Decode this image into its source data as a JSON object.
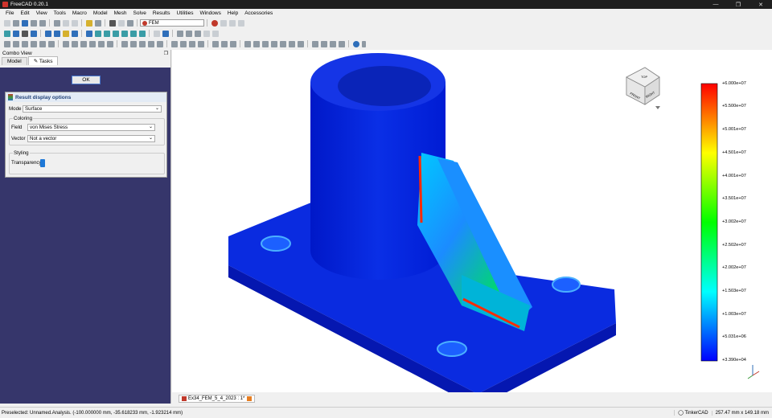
{
  "window": {
    "title": "FreeCAD 0.20.1"
  },
  "menu": [
    "File",
    "Edit",
    "View",
    "Tools",
    "Macro",
    "Model",
    "Mesh",
    "Solve",
    "Results",
    "Utilities",
    "Windows",
    "Help",
    "Accessories"
  ],
  "toolbar": {
    "workbench": "FEM"
  },
  "combo": {
    "title": "Combo View",
    "tabs": [
      "Model",
      "Tasks"
    ],
    "ok_label": "OK",
    "panel_title": "Result display options",
    "mode_label": "Mode",
    "mode_value": "Surface",
    "coloring_label": "Coloring",
    "field_label": "Field",
    "field_value": "von Mises Stress",
    "vector_label": "Vector",
    "vector_value": "Not a vector",
    "styling_label": "Styling",
    "transparency_label": "Transparency",
    "transparency_value": 0.0
  },
  "legend": {
    "labels": [
      "+6.000e+07",
      "+5.500e+07",
      "+5.001e+07",
      "+4.501e+07",
      "+4.001e+07",
      "+3.501e+07",
      "+3.002e+07",
      "+2.502e+07",
      "+2.002e+07",
      "+1.503e+07",
      "+1.003e+07",
      "+5.031e+06",
      "+3.390e+04"
    ],
    "colors": [
      "#ff0000",
      "#ffff00",
      "#00ff00",
      "#00ffff",
      "#0000ff"
    ]
  },
  "document_tab": "Ex34_FEM_5_4_2023 : 1*",
  "status": {
    "message": "Preselected: Unnamed.Analysis. (-100.000000 mm, -35.618233 mm, -1.923214 mm)",
    "navigation": "TinkerCAD",
    "dimensions": "257.47 mm x 149.18 mm"
  }
}
